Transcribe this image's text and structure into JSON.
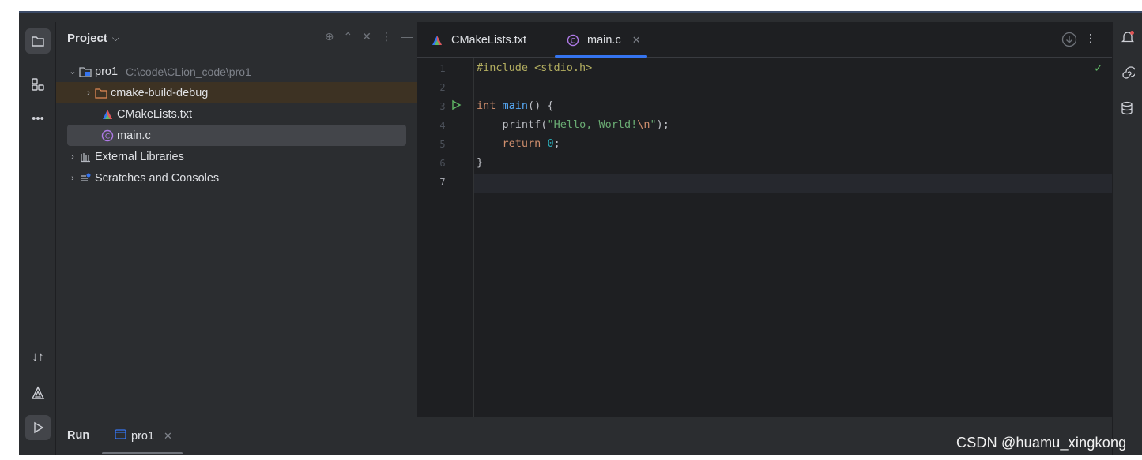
{
  "project_panel": {
    "title": "Project",
    "tree": [
      {
        "name": "pro1",
        "path": "C:\\code\\CLion_code\\pro1",
        "expanded": true
      },
      {
        "name": "cmake-build-debug",
        "expanded": false
      },
      {
        "name": "CMakeLists.txt"
      },
      {
        "name": "main.c",
        "selected": true
      },
      {
        "name": "External Libraries",
        "expanded": false
      },
      {
        "name": "Scratches and Consoles",
        "expanded": false
      }
    ]
  },
  "editor": {
    "tabs": [
      {
        "label": "CMakeLists.txt",
        "active": false
      },
      {
        "label": "main.c",
        "active": true
      }
    ],
    "line_numbers": [
      "1",
      "2",
      "3",
      "4",
      "5",
      "6",
      "7"
    ],
    "code": {
      "l1_pp": "#include <stdio.h>",
      "l3_kw": "int",
      "l3_fn": "main",
      "l3_rest": "() {",
      "l4_fn": "printf",
      "l4_open": "(",
      "l4_str": "\"Hello, World!",
      "l4_esc": "\\n",
      "l4_strend": "\"",
      "l4_close": ");",
      "l5_kw": "return",
      "l5_num": "0",
      "l5_semi": ";",
      "l6": "}"
    }
  },
  "bottom_bar": {
    "run_label": "Run",
    "run_tab": "pro1"
  },
  "watermark": "CSDN @huamu_xingkong",
  "colors": {
    "accent": "#3574f0",
    "run_green": "#5fb865",
    "selection_orange": "#3d3223"
  }
}
